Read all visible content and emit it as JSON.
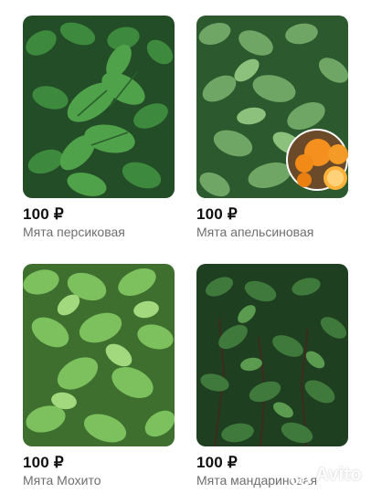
{
  "products": [
    {
      "price": "100 ₽",
      "title": "Мята персиковая",
      "image": "mint-plant-photo"
    },
    {
      "price": "100 ₽",
      "title": "Мята апельсиновая",
      "image": "mint-plant-with-orange-photo"
    },
    {
      "price": "100 ₽",
      "title": "Мята Мохито",
      "image": "mint-plant-photo"
    },
    {
      "price": "100 ₽",
      "title": "Мята мандариновая",
      "image": "mint-plant-photo"
    }
  ],
  "watermark": {
    "text": "Avito"
  },
  "colors": {
    "price": "#111111",
    "title": "#6f6f6f",
    "leaf_dark": "#2f6b34",
    "leaf_light": "#7fc46a",
    "orange": "#f5901e"
  }
}
